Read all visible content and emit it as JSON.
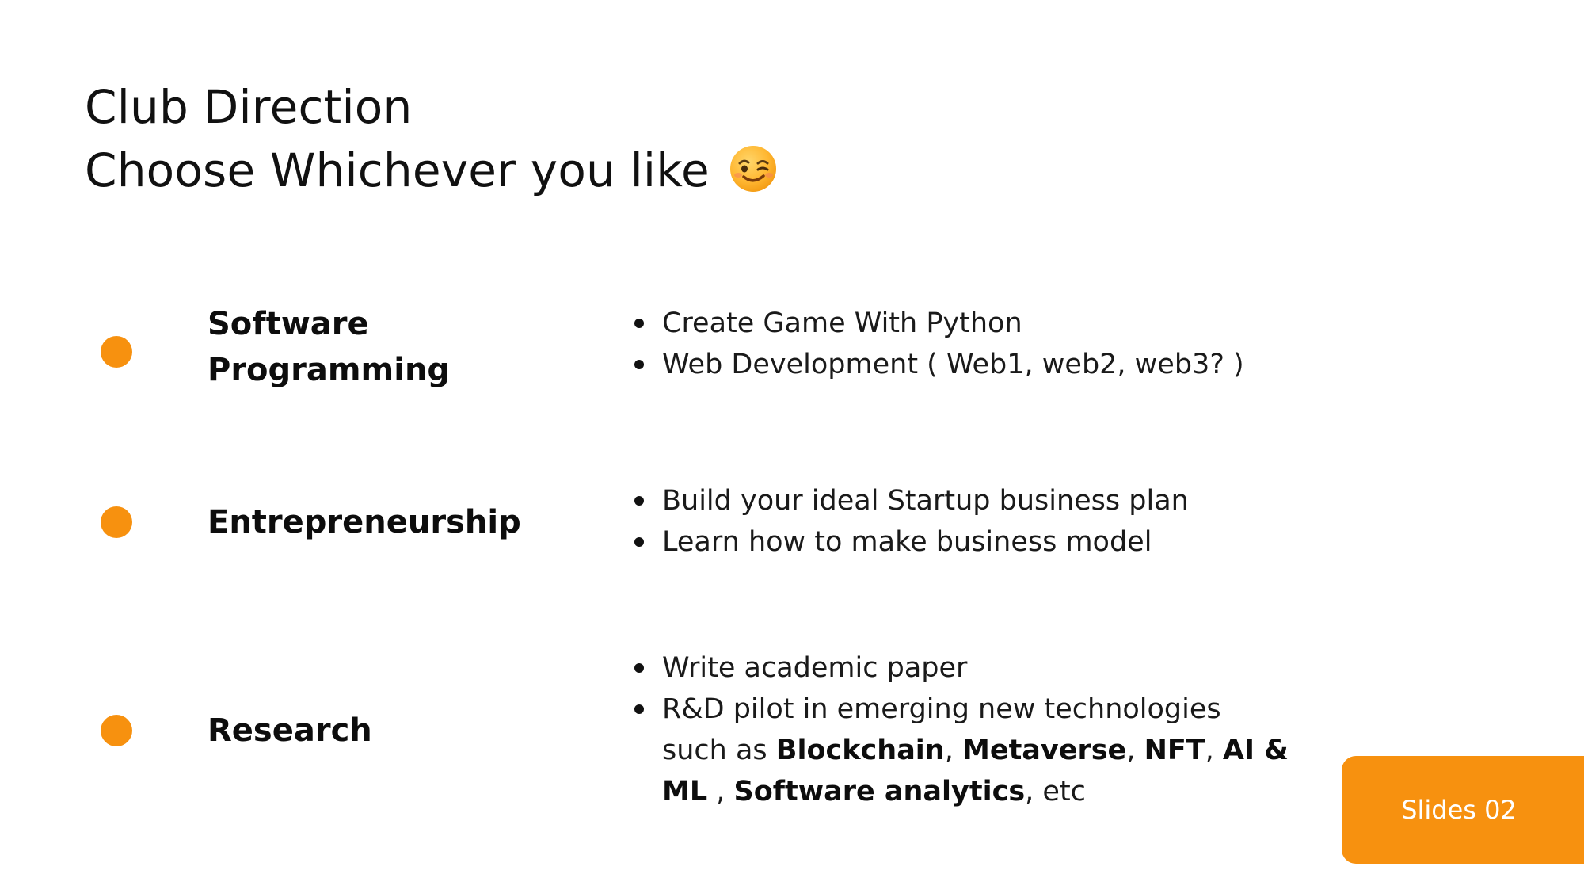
{
  "slide": {
    "title_line1": "Club Direction",
    "title_line2": "Choose Whichever you like",
    "title_emoji": "winking-face-icon",
    "accent_color": "#F7910F"
  },
  "directions": [
    {
      "category_line1": "Software",
      "category_line2": "Programming",
      "bullets": [
        "Create Game With Python",
        "Web Development ( Web1, web2, web3? )"
      ]
    },
    {
      "category_line1": "Entrepreneurship",
      "bullets": [
        "Build your ideal Startup business plan",
        "Learn how to make business model"
      ]
    },
    {
      "category_line1": "Research",
      "bullets": [
        "Write academic paper",
        "R&D pilot in emerging new technologies"
      ],
      "bullet2_continuation": {
        "text_such_as": "such as ",
        "blockchain": "Blockchain",
        "sep1": ", ",
        "metaverse": "Metaverse",
        "sep2": ", ",
        "nft": "NFT",
        "sep3": ", ",
        "ai_ml_part1": "AI &",
        "ai_ml_part2": "ML",
        "sep4": " , ",
        "software_analytics": "Software analytics",
        "etc": ", etc"
      }
    }
  ],
  "footer": {
    "badge_label": "Slides 02"
  }
}
